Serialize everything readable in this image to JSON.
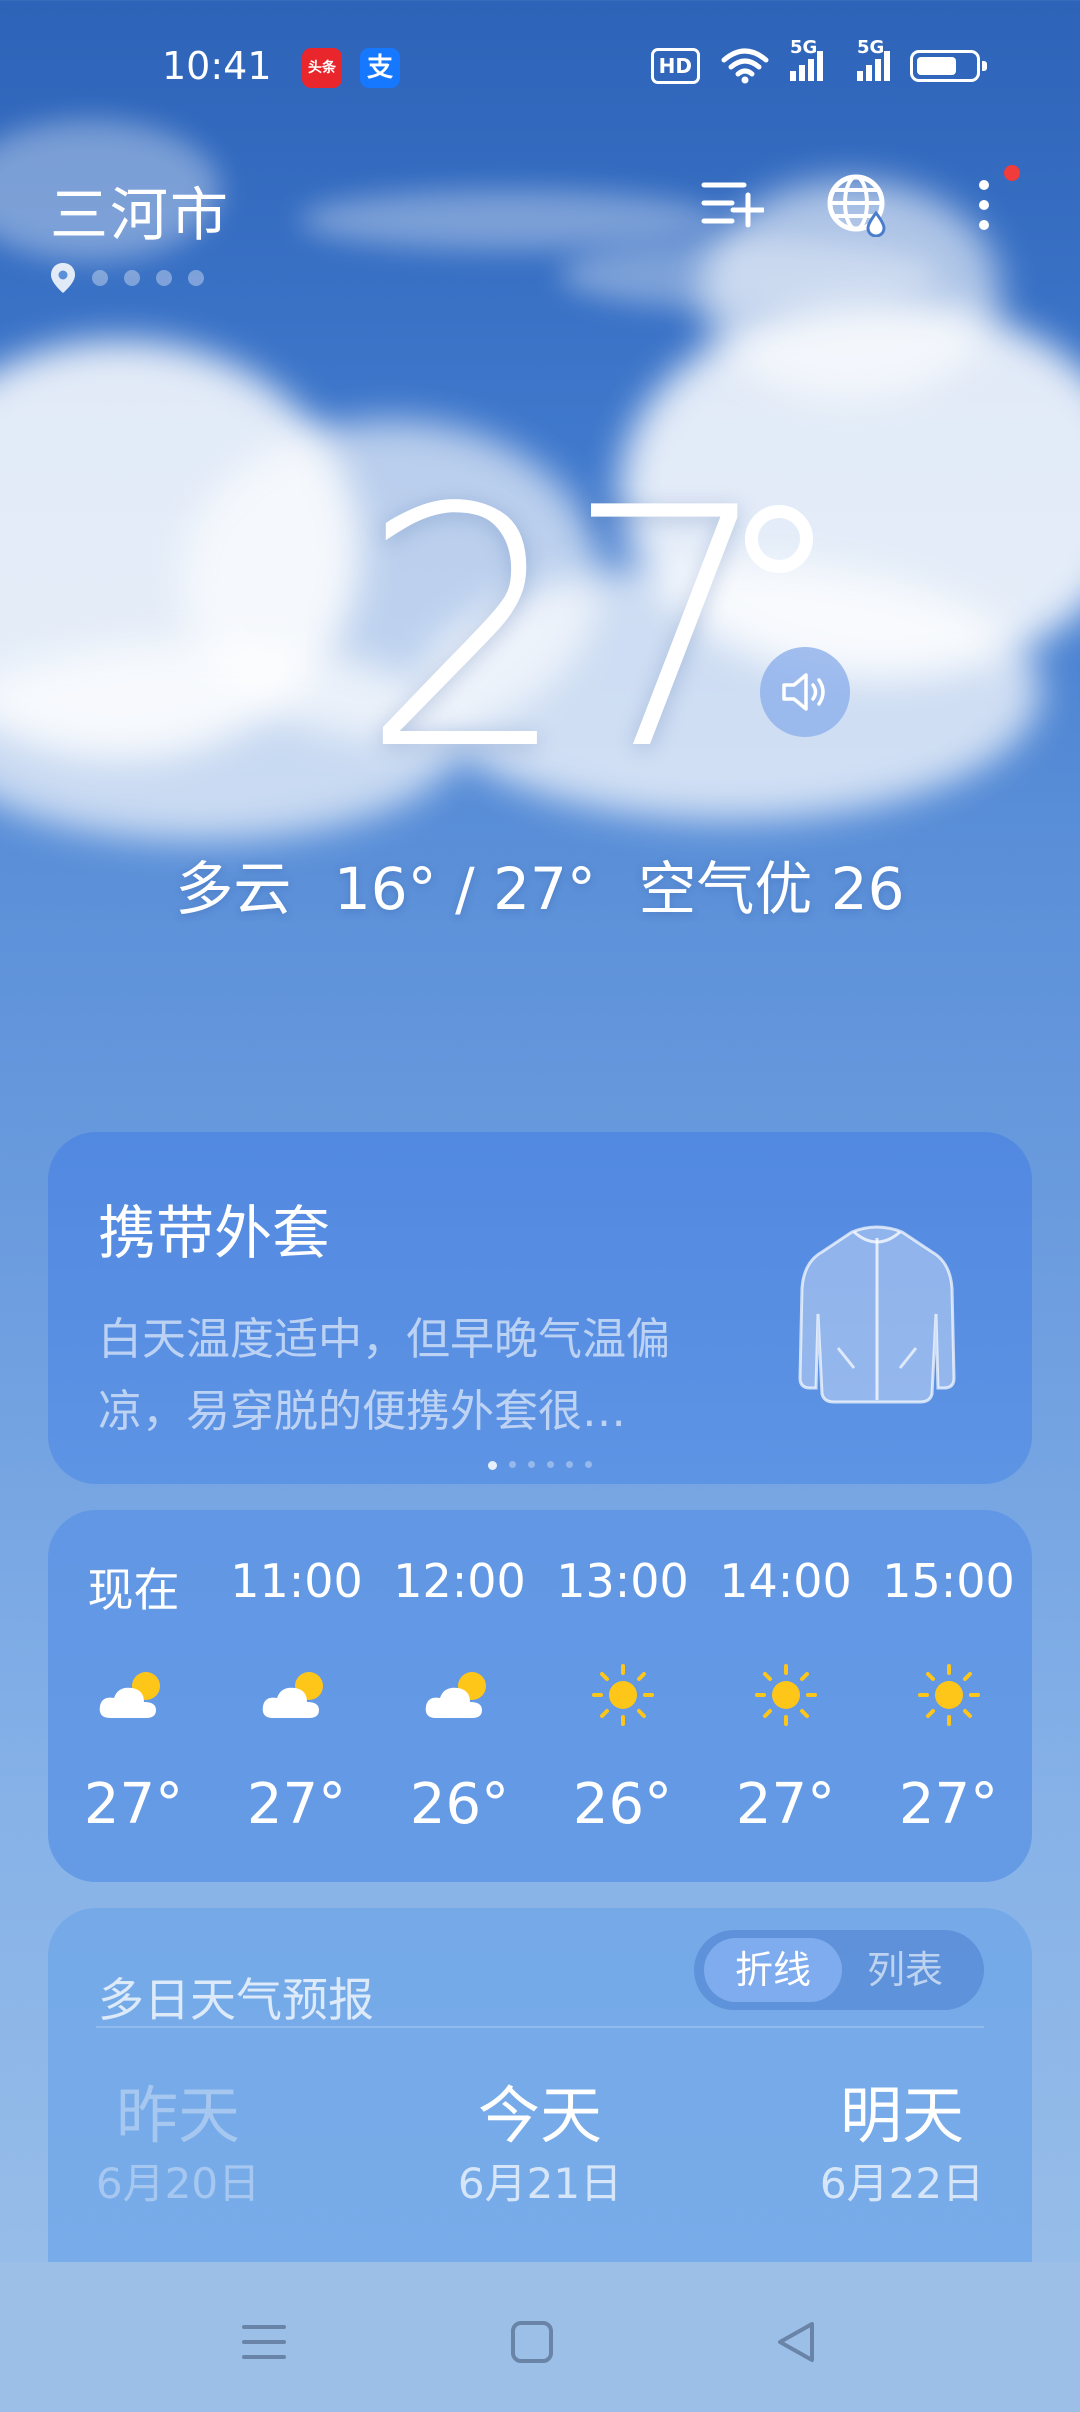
{
  "status_bar": {
    "time": "10:41",
    "apps": [
      {
        "name": "toutiao",
        "label": "头条",
        "color": "#e8262b"
      },
      {
        "name": "alipay",
        "label": "支",
        "color": "#1677ff"
      }
    ],
    "hd_label": "HD",
    "network_labels": [
      "5G",
      "5G"
    ],
    "battery_level": 0.7
  },
  "header": {
    "city": "三河市",
    "page_count": 5,
    "actions": [
      "add-city",
      "globe",
      "more"
    ]
  },
  "current": {
    "temperature": "27",
    "summary": {
      "condition": "多云",
      "range": "16° / 27°",
      "air_quality": "空气优 26"
    }
  },
  "tip_card": {
    "title": "携带外套",
    "body": "白天温度适中，但早晚气温偏凉，易穿脱的便携外套很…",
    "icon": "jacket-icon",
    "carousel_count": 6,
    "carousel_active": 0
  },
  "hourly": [
    {
      "time": "现在",
      "icon": "partly-cloudy-icon",
      "temp": "27°"
    },
    {
      "time": "11:00",
      "icon": "partly-cloudy-icon",
      "temp": "27°"
    },
    {
      "time": "12:00",
      "icon": "partly-cloudy-icon",
      "temp": "26°"
    },
    {
      "time": "13:00",
      "icon": "sunny-icon",
      "temp": "26°"
    },
    {
      "time": "14:00",
      "icon": "sunny-icon",
      "temp": "27°"
    },
    {
      "time": "15:00",
      "icon": "sunny-icon",
      "temp": "27°"
    }
  ],
  "forecast": {
    "title": "多日天气预报",
    "toggle": {
      "selected": "折线",
      "other": "列表"
    },
    "days": [
      {
        "name": "昨天",
        "date": "6月20日"
      },
      {
        "name": "今天",
        "date": "6月21日"
      },
      {
        "name": "明天",
        "date": "6月22日"
      }
    ]
  },
  "colors": {
    "sun": "#ffc61a",
    "notification": "#f23b3b",
    "sky_top": "#2d63b8"
  }
}
